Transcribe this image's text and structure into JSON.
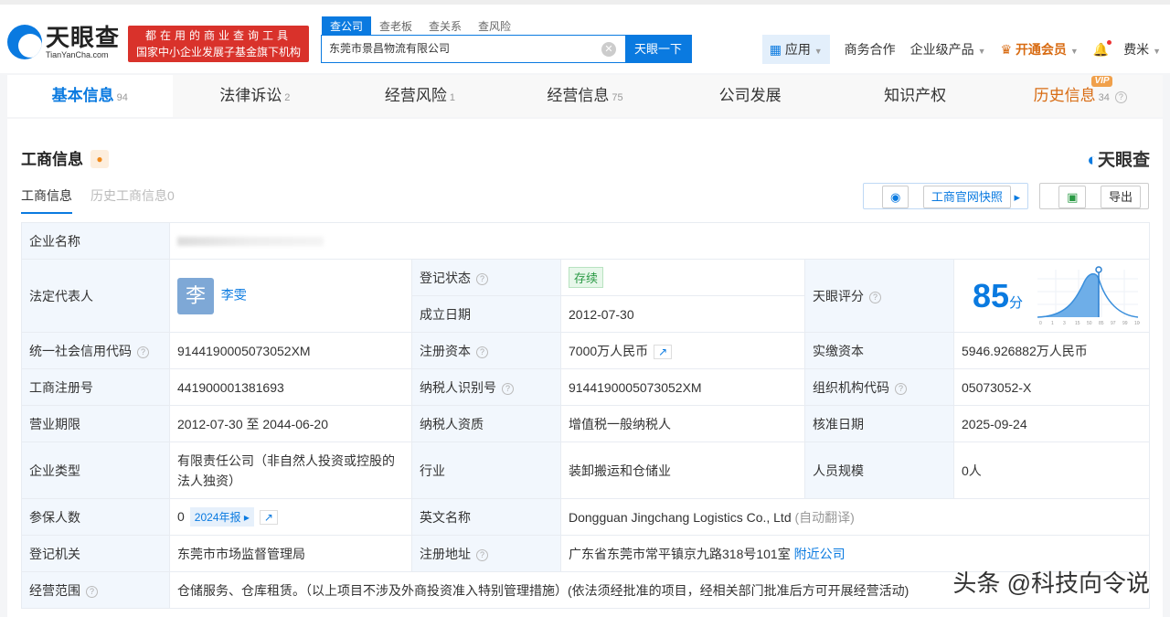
{
  "header": {
    "logo_cn": "天眼查",
    "logo_en": "TianYanCha.com",
    "slogan_1": "都在用的商业查询工具",
    "slogan_2": "国家中小企业发展子基金旗下机构",
    "search_tabs": [
      "查公司",
      "查老板",
      "查关系",
      "查风险"
    ],
    "search_value": "东莞市景昌物流有限公司",
    "search_button": "天眼一下",
    "nav": {
      "apps": "应用",
      "business": "商务合作",
      "enterprise": "企业级产品",
      "vip": "开通会员",
      "user": "费米"
    }
  },
  "tabs": [
    {
      "label": "基本信息",
      "count": "94"
    },
    {
      "label": "法律诉讼",
      "count": "2"
    },
    {
      "label": "经营风险",
      "count": "1"
    },
    {
      "label": "经营信息",
      "count": "75"
    },
    {
      "label": "公司发展",
      "count": ""
    },
    {
      "label": "知识产权",
      "count": ""
    },
    {
      "label": "历史信息",
      "count": "34",
      "tag": "VIP"
    }
  ],
  "section": {
    "title": "工商信息",
    "brand": "天眼查",
    "subtabs": [
      "工商信息",
      "历史工商信息0"
    ],
    "snapshot": "工商官网快照",
    "export": "导出"
  },
  "info": {
    "name_label": "企业名称",
    "legal_label": "法定代表人",
    "legal_avatar": "李",
    "legal_name": "李雯",
    "status_label": "登记状态",
    "status": "存续",
    "founded_label": "成立日期",
    "founded": "2012-07-30",
    "score_label": "天眼评分",
    "score": "85",
    "score_unit": "分",
    "score_ticks": [
      "0",
      "1",
      "3",
      "15",
      "50",
      "85",
      "97",
      "99",
      "100"
    ],
    "credit_label": "统一社会信用代码",
    "credit": "9144190005073052XM",
    "capital_label": "注册资本",
    "capital": "7000万人民币",
    "paid_label": "实缴资本",
    "paid": "5946.926882万人民币",
    "regno_label": "工商注册号",
    "regno": "441900001381693",
    "taxid_label": "纳税人识别号",
    "taxid": "9144190005073052XM",
    "org_label": "组织机构代码",
    "org": "05073052-X",
    "term_label": "营业期限",
    "term": "2012-07-30 至 2044-06-20",
    "taxq_label": "纳税人资质",
    "taxq": "增值税一般纳税人",
    "approve_label": "核准日期",
    "approve": "2025-09-24",
    "type_label": "企业类型",
    "type": "有限责任公司（非自然人投资或控股的法人独资）",
    "industry_label": "行业",
    "industry": "装卸搬运和仓储业",
    "staff_label": "人员规模",
    "staff": "0人",
    "insured_label": "参保人数",
    "insured": "0",
    "insured_report": "2024年报",
    "en_label": "英文名称",
    "en": "Dongguan Jingchang Logistics Co., Ltd",
    "en_note": "(自动翻译)",
    "authority_label": "登记机关",
    "authority": "东莞市市场监督管理局",
    "addr_label": "注册地址",
    "addr": "广东省东莞市常平镇京九路318号101室",
    "addr_link": "附近公司",
    "scope_label": "经营范围",
    "scope": "仓储服务、仓库租赁。（以上项目不涉及外商投资准入特别管理措施）(依法须经批准的项目，经相关部门批准后方可开展经营活动)"
  },
  "watermark": "头条 @科技向令说"
}
